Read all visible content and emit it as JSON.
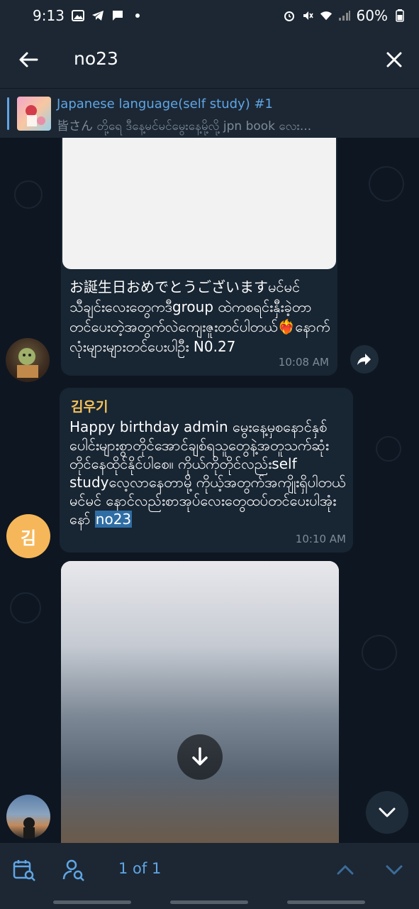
{
  "status_bar": {
    "time": "9:13",
    "battery": "60%",
    "icons": [
      "image-icon",
      "telegram-icon",
      "chat-icon",
      "dot-icon",
      "alarm-icon",
      "mute-icon",
      "wifi-icon",
      "signal-icon",
      "battery-icon"
    ]
  },
  "search": {
    "query": "no23"
  },
  "pinned": {
    "title": "Japanese language(self study) #1",
    "subtitle": "皆さん တို့ရေ ဒီနေ့မင်မင်မွေးနေ့မို့လို့ jpn book လေး..."
  },
  "messages": [
    {
      "text": "お誕生日おめでとうございますမင်မင်သီချင်းလေးတွေကဒီgroup ထဲကစရင်းနှီးခဲ့တာတင်ပေးတဲ့အတွက်လဲကျေးဇူးတင်ပါတယ်❤️‍🔥နောက်လုံးများများတင်ပေးပါဦး N0.27",
      "time": "10:08 AM"
    },
    {
      "sender": "김우기",
      "avatar_letter": "김",
      "text_before": "Happy birthday admin မွေးနေ့မှစနောင်နှစ်ပေါင်းများစွာတိုင်အောင်ချစ်ရသူတွေနဲ့အတူသက်ဆုံးတိုင်နေထိုင်နိုင်ပါစေ။ ကိုယ်ကိုတိုင်လည်းself studyလေ့လာနေတာမို့ ကိုယ့်အတွက်အကျိုးရှိပါတယ်မင်မင် နောင်လည်းစာအုပ်လေးတွေထပ်တင်ပေးပါအုံးနော် ",
      "highlight": "no23",
      "time": "10:10 AM"
    }
  ],
  "bottom_bar": {
    "result_count": "1 of 1"
  },
  "colors": {
    "accent": "#5fa6e6",
    "sender_name": "#f5c25a",
    "bubble": "#182533",
    "background": "#0e1621",
    "bar": "#1c2733"
  }
}
